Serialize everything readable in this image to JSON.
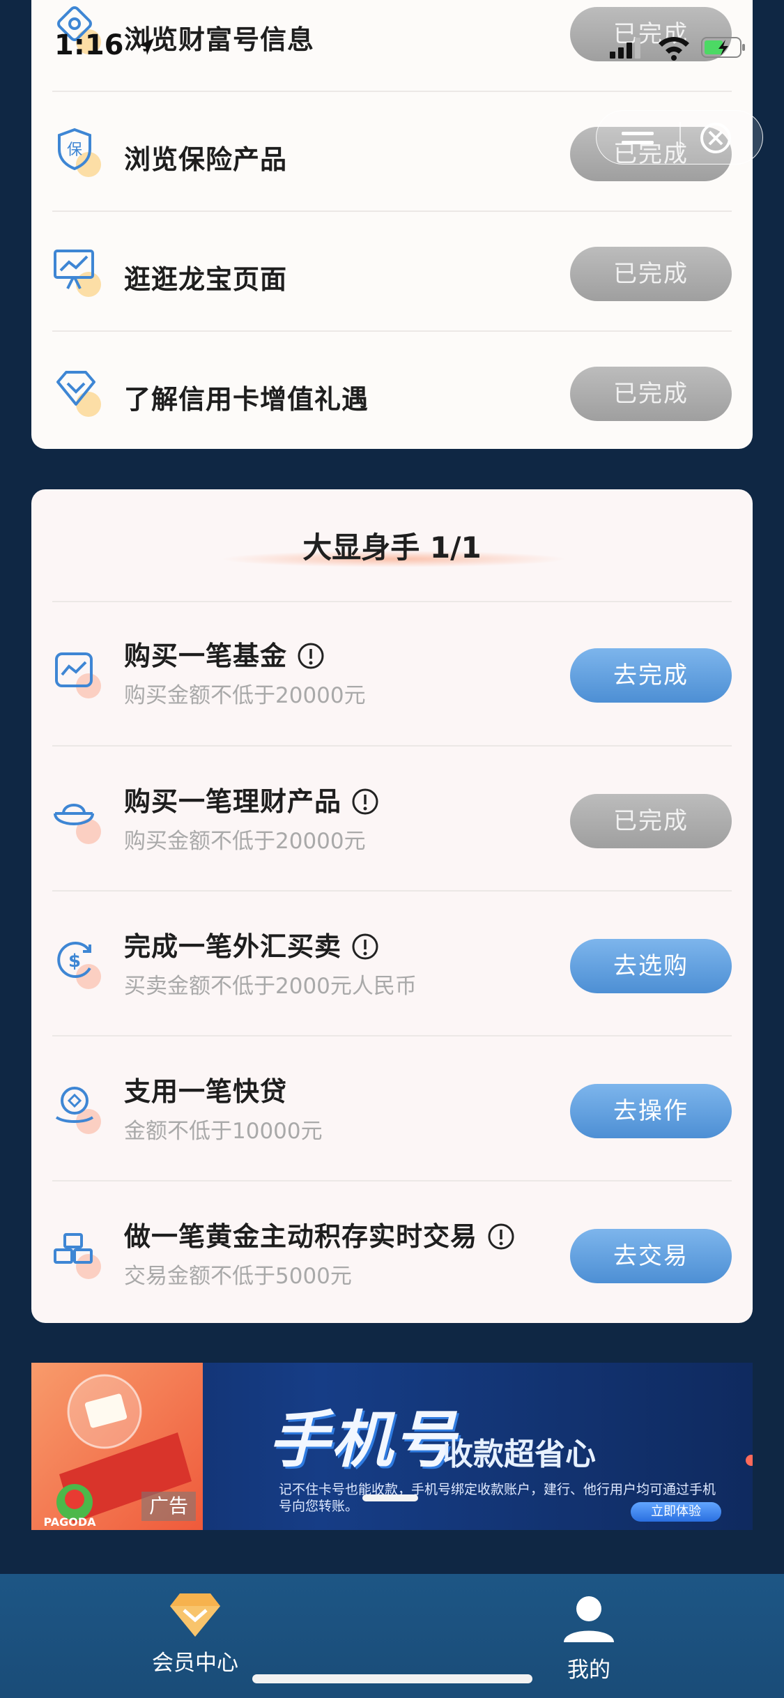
{
  "status_bar": {
    "time": "1:16"
  },
  "top_tasks": [
    {
      "title": "浏览财富号信息",
      "button": "已完成",
      "icon": "wealth-icon"
    },
    {
      "title": "浏览保险产品",
      "button": "已完成",
      "icon": "insurance-shield-icon"
    },
    {
      "title": "逛逛龙宝页面",
      "button": "已完成",
      "icon": "chart-board-icon"
    },
    {
      "title": "了解信用卡增值礼遇",
      "button": "已完成",
      "icon": "diamond-icon"
    }
  ],
  "section": {
    "title": "大显身手 1/1",
    "tasks": [
      {
        "title": "购买一笔基金",
        "subtitle": "购买金额不低于20000元",
        "button": "去完成",
        "state": "go",
        "info": true,
        "icon": "fund-chart-icon"
      },
      {
        "title": "购买一笔理财产品",
        "subtitle": "购买金额不低于20000元",
        "button": "已完成",
        "state": "done",
        "info": true,
        "icon": "gold-ingot-icon"
      },
      {
        "title": "完成一笔外汇买卖",
        "subtitle": "买卖金额不低于2000元人民币",
        "button": "去选购",
        "state": "go",
        "info": true,
        "icon": "dollar-exchange-icon"
      },
      {
        "title": "支用一笔快贷",
        "subtitle": "金额不低于10000元",
        "button": "去操作",
        "state": "go",
        "info": false,
        "icon": "loan-coin-icon"
      },
      {
        "title": "做一笔黄金主动积存实时交易",
        "subtitle": "交易金额不低于5000元",
        "button": "去交易",
        "state": "go",
        "info": true,
        "icon": "gold-bars-icon"
      }
    ]
  },
  "banner": {
    "ad_tag": "广告",
    "headline": "手机号",
    "subheadline": "收款超省心",
    "description": "记不住卡号也能收款，手机号绑定收款账户，建行、他行用户均可通过手机号向您转账。",
    "cta": "立即体验",
    "brand": "PAGODA"
  },
  "tabbar": {
    "items": [
      {
        "label": "会员中心",
        "icon": "diamond-member-icon"
      },
      {
        "label": "我的",
        "icon": "user-profile-icon"
      }
    ]
  },
  "colors": {
    "background": "#0f2744",
    "button_go": "#5b9ce0",
    "button_done": "#aaaaaa",
    "tabbar": "#1b4f7c"
  }
}
